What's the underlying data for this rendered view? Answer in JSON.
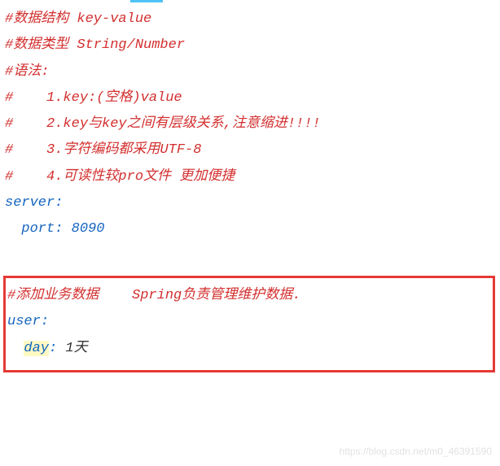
{
  "comments": {
    "c1": "#数据结构 key-value",
    "c2": "#数据类型 String/Number",
    "c3": "#语法:",
    "c4": "#    1.key:(空格)value",
    "c5": "#    2.key与key之间有层级关系,注意缩进!!!!",
    "c6": "#    3.字符编码都采用UTF-8",
    "c7": "#    4.可读性较pro文件 更加便捷"
  },
  "server": {
    "key": "server",
    "port_key": "port",
    "port_value": "8090"
  },
  "box": {
    "comment": "#添加业务数据    Spring负责管理维护数据.",
    "user_key": "user",
    "day_key": "day",
    "day_value": "1天"
  },
  "watermark": "https://blog.csdn.net/m0_46391590"
}
